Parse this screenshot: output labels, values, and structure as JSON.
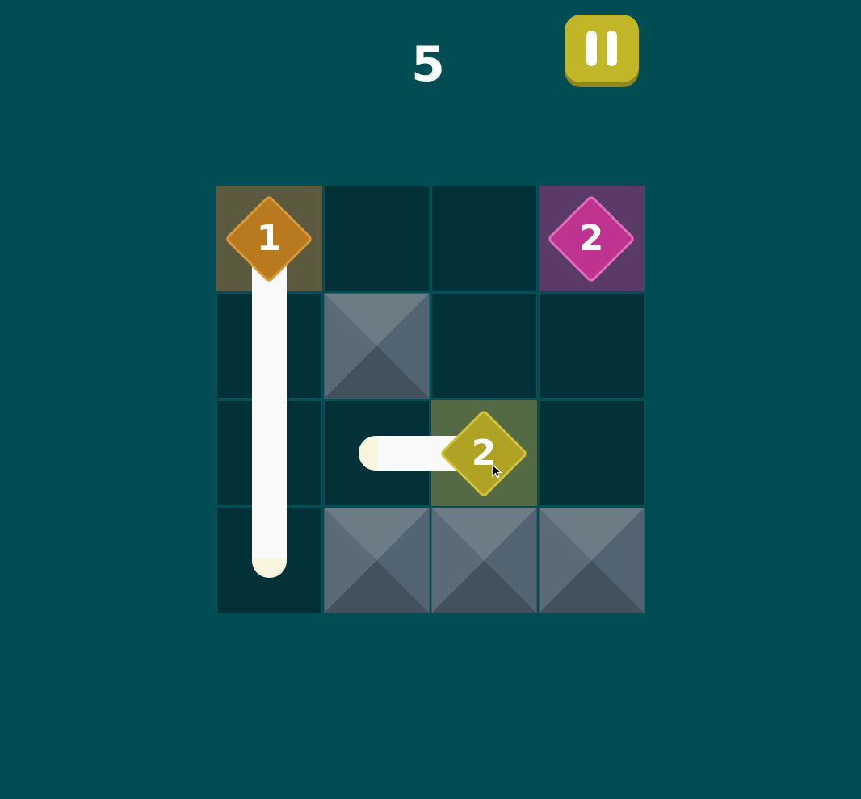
{
  "level": "5",
  "colors": {
    "background": "#024d53",
    "orange_tile": "#b9791f",
    "magenta_tile": "#be3290",
    "olive_tile": "#b0a224",
    "pause_button": "#c1b628"
  },
  "board": {
    "rows": 4,
    "cols": 4,
    "tiles": [
      {
        "row": 1,
        "col": 1,
        "number": "1",
        "color": "orange"
      },
      {
        "row": 1,
        "col": 4,
        "number": "2",
        "color": "magenta"
      },
      {
        "row": 3,
        "col": 3,
        "number": "2",
        "color": "olive"
      }
    ],
    "blocked_cells": [
      {
        "row": 2,
        "col": 2
      },
      {
        "row": 4,
        "col": 2
      },
      {
        "row": 4,
        "col": 3
      },
      {
        "row": 4,
        "col": 4
      }
    ]
  },
  "controls": {
    "pause_icon": "pause-icon"
  }
}
